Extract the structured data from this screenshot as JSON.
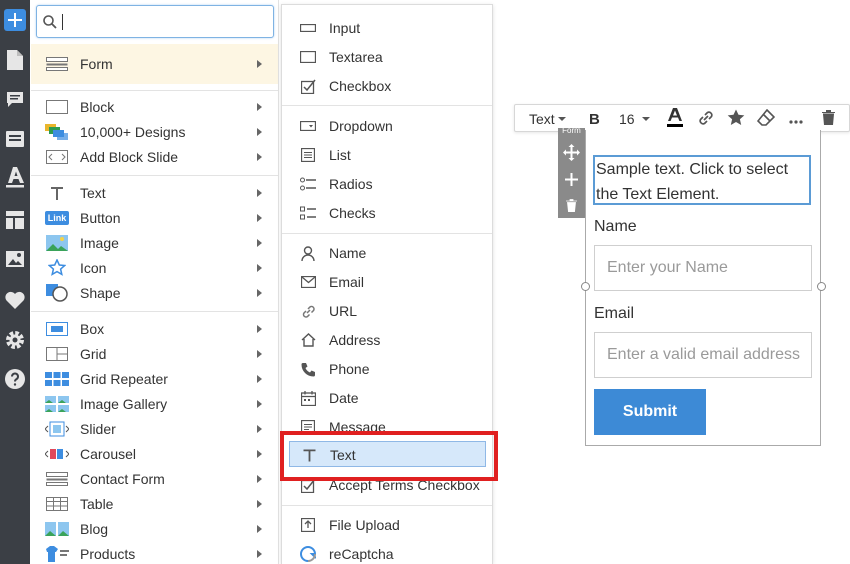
{
  "search": {
    "value": "",
    "placeholder": ""
  },
  "insert_menu": {
    "selected": "Form",
    "groups": [
      [
        "Block",
        "10,000+ Designs",
        "Add Block Slide"
      ],
      [
        "Text",
        "Button",
        "Image",
        "Icon",
        "Shape"
      ],
      [
        "Box",
        "Grid",
        "Grid Repeater",
        "Image Gallery",
        "Slider",
        "Carousel",
        "Contact Form",
        "Table",
        "Blog",
        "Products"
      ]
    ]
  },
  "button_icon_text": "Link",
  "form_submenu": {
    "groups": [
      [
        "Input",
        "Textarea",
        "Checkbox"
      ],
      [
        "Dropdown",
        "List",
        "Radios",
        "Checks"
      ],
      [
        "Name",
        "Email",
        "URL",
        "Address",
        "Phone",
        "Date",
        "Message",
        "Text",
        "Accept Terms Checkbox"
      ],
      [
        "File Upload",
        "reCaptcha"
      ]
    ],
    "highlighted": "Text"
  },
  "toolbar": {
    "type": "Text",
    "bold": "B",
    "font_size": "16"
  },
  "side_tools_tag": "Form",
  "form": {
    "text_element": "Sample text. Click to select the Text Element.",
    "name_label": "Name",
    "name_placeholder": "Enter your Name",
    "email_label": "Email",
    "email_placeholder": "Enter a valid email address",
    "submit": "Submit"
  },
  "colors": {
    "accent": "#3d8de0",
    "highlight_box": "#e02020",
    "sidebar": "#3b3f45",
    "submit_bg": "#3d8ad6"
  }
}
